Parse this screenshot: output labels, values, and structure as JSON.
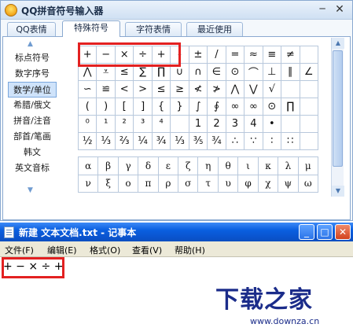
{
  "qq_window": {
    "title": "QQ拼音符号输入器",
    "minimize_label": "─",
    "close_label": "✕",
    "tabs": [
      "QQ表情",
      "特殊符号",
      "字符表情",
      "最近使用"
    ],
    "active_tab": "特殊符号",
    "categories": [
      "标点符号",
      "数字序号",
      "数学/单位",
      "希腊/俄文",
      "拼音/注音",
      "部首/笔画",
      "韩文",
      "英文音标"
    ],
    "selected_category": "数学/单位",
    "symbol_rows": [
      [
        "+",
        "−",
        "×",
        "÷",
        "+",
        "-",
        "±",
        "/",
        "=",
        "≈",
        "≡",
        "≠",
        ""
      ],
      [
        "⋀",
        "⩡",
        "≤",
        "∑",
        "∏",
        "∪",
        "∩",
        "∈",
        "⊙",
        "⌒",
        "⊥",
        "∥",
        "∠"
      ],
      [
        "∽",
        "≌",
        "<",
        ">",
        "≤",
        "≥",
        "≮",
        "≯",
        "⋀",
        "⋁",
        "√",
        "",
        ""
      ],
      [
        "(",
        ")",
        "[",
        "]",
        "{",
        "}",
        "∫",
        "∮",
        "∞",
        "∞",
        "⊙",
        "∏",
        ""
      ],
      [
        "⁰",
        "¹",
        "²",
        "³",
        "⁴",
        "",
        "1",
        "2",
        "3",
        "4",
        "•",
        "",
        ""
      ],
      [
        "½",
        "⅓",
        "⅔",
        "¼",
        "¾",
        "⅓",
        "⅗",
        "¾",
        "∴",
        "∵",
        "∶",
        "∷",
        ""
      ]
    ],
    "greek_rows": [
      [
        "α",
        "β",
        "γ",
        "δ",
        "ε",
        "ζ",
        "η",
        "θ",
        "ι",
        "κ",
        "λ",
        "μ"
      ],
      [
        "ν",
        "ξ",
        "ο",
        "π",
        "ρ",
        "σ",
        "τ",
        "υ",
        "φ",
        "χ",
        "ψ",
        "ω"
      ]
    ],
    "scroll_up_icon": "▲",
    "scroll_down_icon": "▼"
  },
  "notepad": {
    "title": "新建 文本文档.txt - 记事本",
    "menus": [
      "文件(F)",
      "编辑(E)",
      "格式(O)",
      "查看(V)",
      "帮助(H)"
    ],
    "content": "+ − × ÷ +",
    "buttons": {
      "minimize": "_",
      "maximize": "□",
      "close": "✕"
    }
  },
  "watermark": {
    "main": "下载之家",
    "sub": "www.downza.cn"
  },
  "colors": {
    "highlight": "#e32121",
    "selection": "#cfe3fa",
    "notepad_title": "#0a5fe0",
    "watermark": "#1b2c8a"
  }
}
